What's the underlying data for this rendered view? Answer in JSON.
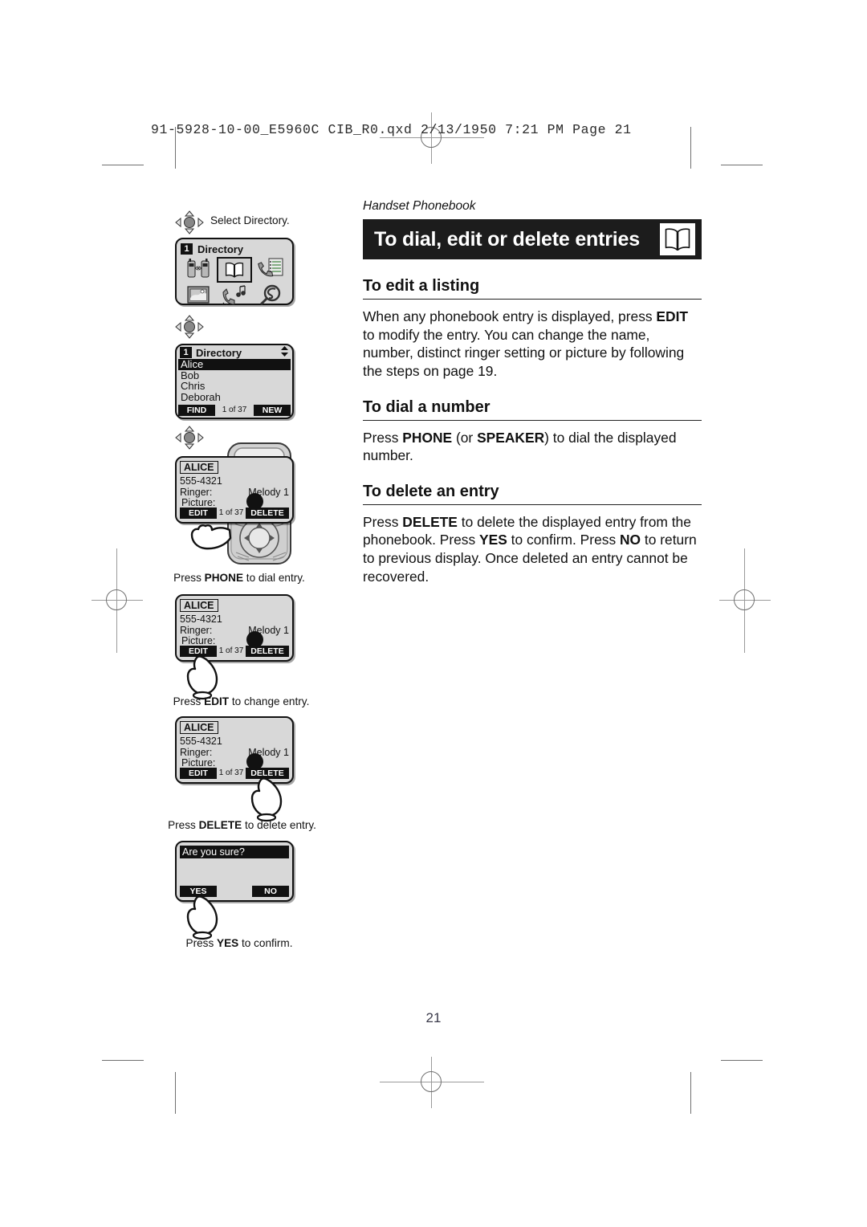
{
  "print_marks": {
    "slug_line": "91-5928-10-00_E5960C CIB_R0.qxd  2/13/1950  7:21 PM  Page 21"
  },
  "page": {
    "number": "21",
    "running_head": "Handset Phonebook",
    "title": "To dial, edit or delete entries",
    "title_icon": "open-book-icon"
  },
  "sections": [
    {
      "heading": "To edit a listing",
      "body_html": "When any phonebook entry is displayed, press <b>EDIT</b> to modify the entry. You can change the name, number, distinct ringer setting or picture by following the steps on page 19."
    },
    {
      "heading": "To dial a number",
      "body_html": "Press <b>PHONE</b> (or <b>SPEAKER</b>) to dial the displayed number."
    },
    {
      "heading": "To delete an entry",
      "body_html": "Press <b>DELETE</b> to delete the displayed entry from the phonebook. Press <b>YES</b> to confirm. Press <b>NO</b> to return to previous display. Once deleted an entry cannot be recovered."
    }
  ],
  "figures": {
    "step1": {
      "nav_icon": "dpad-navigation-icon",
      "instruction": "Select Directory.",
      "screen": {
        "badge": "1",
        "title": "Directory",
        "icons": [
          "intercom-handsets-icon",
          "open-book-directory-icon",
          "call-log-icon",
          "picture-frame-icon",
          "ringer-melody-icon",
          "caller-id-search-icon"
        ],
        "selected_icon_index": 1
      }
    },
    "step2": {
      "nav_icon": "dpad-navigation-icon",
      "screen": {
        "badge": "1",
        "title": "Directory",
        "scroll_icon": "up-down-arrows-icon",
        "entries": [
          "Alice",
          "Bob",
          "Chris",
          "Deborah"
        ],
        "highlighted_index": 0,
        "softkey_left": "FIND",
        "counter": "1 of 37",
        "softkey_right": "NEW"
      }
    },
    "step3": {
      "nav_icon": "dpad-navigation-icon",
      "screen": {
        "name": "ALICE",
        "number": "555-4321",
        "ringer_label": "Ringer:",
        "ringer_value": "Melody 1",
        "picture_label": "Picture:",
        "picture_value": "filled-circle-icon",
        "softkey_left": "EDIT",
        "counter": "1 of 37",
        "softkey_right": "DELETE"
      },
      "device_illustration": "cordless-handset-keypad",
      "hand_icon": "pointing-hand-icon",
      "caption_html": "Press <b>PHONE</b> to dial entry."
    },
    "step4": {
      "screen": {
        "name": "ALICE",
        "number": "555-4321",
        "ringer_label": "Ringer:",
        "ringer_value": "Melody 1",
        "picture_label": "Picture:",
        "picture_value": "filled-circle-icon",
        "softkey_left": "EDIT",
        "counter": "1 of 37",
        "softkey_right": "DELETE"
      },
      "hand_icon": "pointing-hand-icon",
      "hand_target": "EDIT",
      "caption_html": "Press <b>EDIT</b> to change entry."
    },
    "step5": {
      "screen": {
        "name": "ALICE",
        "number": "555-4321",
        "ringer_label": "Ringer:",
        "ringer_value": "Melody 1",
        "picture_label": "Picture:",
        "picture_value": "filled-circle-icon",
        "softkey_left": "EDIT",
        "counter": "1 of 37",
        "softkey_right": "DELETE"
      },
      "hand_icon": "pointing-hand-icon",
      "hand_target": "DELETE",
      "caption_html": "Press <b>DELETE</b> to delete entry."
    },
    "step6": {
      "screen": {
        "prompt": "Are you sure?",
        "softkey_left": "YES",
        "softkey_right": "NO"
      },
      "hand_icon": "pointing-hand-icon",
      "hand_target": "YES",
      "caption_html": "Press <b>YES</b> to confirm."
    }
  },
  "colors": {
    "title_bar_bg": "#1c1c1c",
    "lcd_bg": "#d8d8d8",
    "ink": "#111111",
    "mark_gray": "#6f6f6f"
  }
}
